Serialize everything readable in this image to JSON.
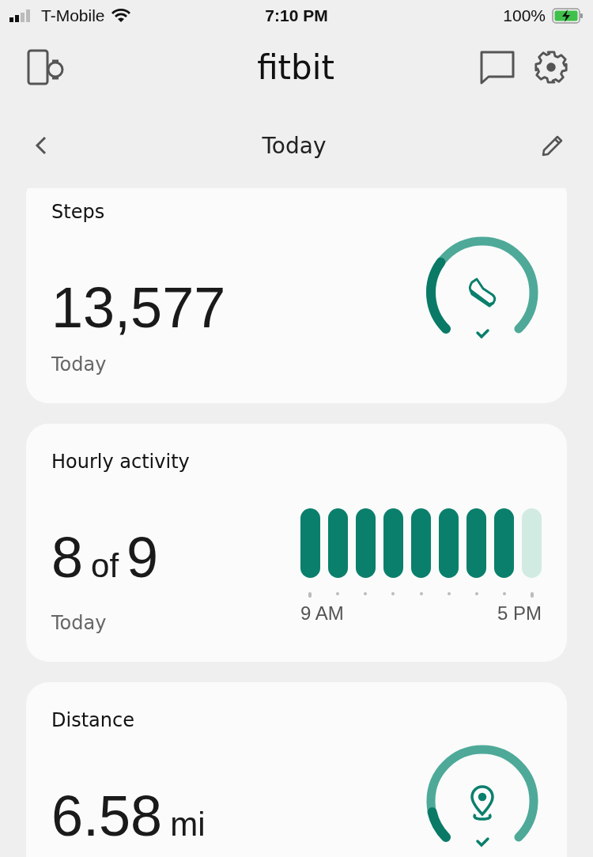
{
  "status_bar": {
    "carrier": "T-Mobile",
    "time": "7:10 PM",
    "battery": "100%",
    "charging": true
  },
  "header": {
    "title": "fitbit"
  },
  "date_nav": {
    "title": "Today"
  },
  "cards": [
    {
      "kind": "gauge",
      "title": "Steps",
      "value": "13,577",
      "subtitle": "Today",
      "goal_met": true
    },
    {
      "kind": "hourly",
      "title": "Hourly activity",
      "value": "8",
      "connector": "of",
      "total": "9",
      "subtitle": "Today",
      "hours": [
        {
          "met": true
        },
        {
          "met": true
        },
        {
          "met": true
        },
        {
          "met": true
        },
        {
          "met": true
        },
        {
          "met": true
        },
        {
          "met": true
        },
        {
          "met": true
        },
        {
          "met": false
        }
      ],
      "start_label": "9 AM",
      "end_label": "5 PM"
    },
    {
      "kind": "gauge",
      "title": "Distance",
      "value": "6.58",
      "unit": "mi",
      "goal_met": true
    }
  ]
}
